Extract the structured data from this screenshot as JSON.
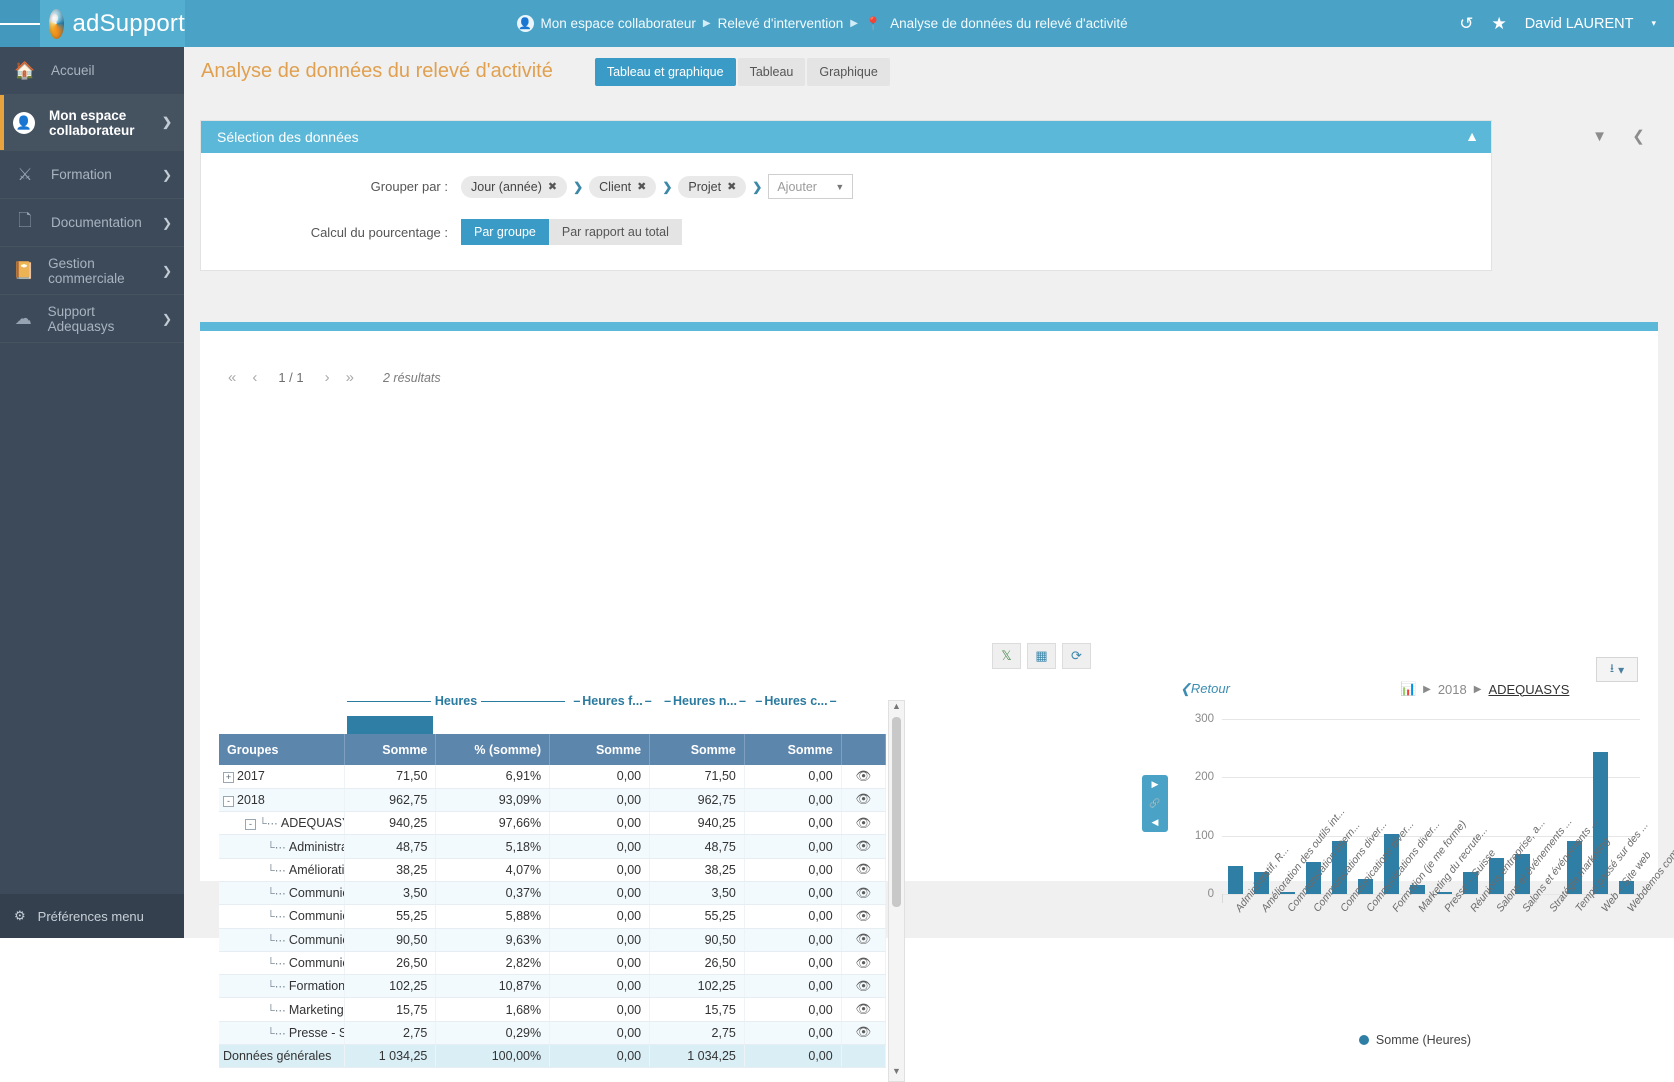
{
  "topbar": {
    "brand": "adSupport",
    "menu_icon": "hamburger-icon",
    "breadcrumb": [
      {
        "label": "Mon espace collaborateur",
        "icon": "user-circle-icon"
      },
      {
        "label": "Relevé d'intervention",
        "icon": ""
      },
      {
        "label": "Analyse de données du relevé d'activité",
        "icon": "pin-icon"
      }
    ],
    "history_icon": "history-icon",
    "favorite_icon": "star-icon",
    "user": "David LAURENT",
    "user_caret": "▾"
  },
  "sidebar": {
    "items": [
      {
        "label": "Accueil",
        "icon": "home-icon",
        "chevron": "",
        "active": false
      },
      {
        "label": "Mon espace collaborateur",
        "icon": "user-circle-icon",
        "chevron": "❯",
        "active": true
      },
      {
        "label": "Formation",
        "icon": "training-icon",
        "chevron": "❯",
        "active": false
      },
      {
        "label": "Documentation",
        "icon": "documents-icon",
        "chevron": "❯",
        "active": false
      },
      {
        "label": "Gestion commerciale",
        "icon": "contact-book-icon",
        "chevron": "❯",
        "active": false
      },
      {
        "label": "Support Adequasys",
        "icon": "support-cloud-icon",
        "chevron": "❯",
        "active": false
      }
    ],
    "footer": {
      "label": "Préférences menu",
      "icon": "gear-icon"
    }
  },
  "page": {
    "title": "Analyse de données du relevé d'activité",
    "tabs": [
      {
        "label": "Tableau et graphique",
        "selected": true
      },
      {
        "label": "Tableau",
        "selected": false
      },
      {
        "label": "Graphique",
        "selected": false
      }
    ]
  },
  "selection_panel": {
    "title": "Sélection des données",
    "collapse_icon": "chevron-up-icon",
    "group_by_label": "Grouper par :",
    "group_by_chips": [
      "Jour (année)",
      "Client",
      "Projet"
    ],
    "chip_remove_glyph": "✖",
    "arrow_glyph": "❯",
    "add_placeholder": "Ajouter",
    "percent_label": "Calcul du pourcentage :",
    "percent_options": [
      {
        "label": "Par groupe",
        "selected": true
      },
      {
        "label": "Par rapport au total",
        "selected": false
      }
    ]
  },
  "side_tools": [
    {
      "name": "filter-icon",
      "glyph": "▼"
    },
    {
      "name": "collapse-panel-icon",
      "glyph": "❮"
    }
  ],
  "results": {
    "pager": {
      "first": "«",
      "prev": "‹",
      "page": "1 / 1",
      "next": "›",
      "last": "»",
      "count": "2 résultats"
    },
    "table_tools": [
      {
        "name": "export-excel-icon",
        "glyph": "X"
      },
      {
        "name": "columns-icon",
        "glyph": "▥"
      },
      {
        "name": "refresh-icon",
        "glyph": "⟳"
      }
    ],
    "group_headers": [
      {
        "label": "Heures",
        "wide": true
      },
      {
        "label": "Heures f...",
        "wide": false
      },
      {
        "label": "Heures n...",
        "wide": false
      },
      {
        "label": "Heures c...",
        "wide": false
      }
    ],
    "columns": [
      "Groupes",
      "Somme",
      "% (somme)",
      "Somme",
      "Somme",
      "Somme",
      ""
    ],
    "rows": [
      {
        "indent": 0,
        "toggle": "+",
        "label": "2017",
        "c1": "71,50",
        "c2": "6,91%",
        "c3": "0,00",
        "c4": "71,50",
        "c5": "0,00",
        "eye": "👁"
      },
      {
        "indent": 0,
        "toggle": "-",
        "label": "2018",
        "c1": "962,75",
        "c2": "93,09%",
        "c3": "0,00",
        "c4": "962,75",
        "c5": "0,00",
        "eye": "👁"
      },
      {
        "indent": 1,
        "toggle": "-",
        "label": "ADEQUASYS",
        "c1": "940,25",
        "c2": "97,66%",
        "c3": "0,00",
        "c4": "940,25",
        "c5": "0,00",
        "eye": "👁"
      },
      {
        "indent": 2,
        "toggle": "",
        "label": "Administra",
        "c1": "48,75",
        "c2": "5,18%",
        "c3": "0,00",
        "c4": "48,75",
        "c5": "0,00",
        "eye": "👁"
      },
      {
        "indent": 2,
        "toggle": "",
        "label": "Améliorati",
        "c1": "38,25",
        "c2": "4,07%",
        "c3": "0,00",
        "c4": "38,25",
        "c5": "0,00",
        "eye": "👁"
      },
      {
        "indent": 2,
        "toggle": "",
        "label": "Communic",
        "c1": "3,50",
        "c2": "0,37%",
        "c3": "0,00",
        "c4": "3,50",
        "c5": "0,00",
        "eye": "👁"
      },
      {
        "indent": 2,
        "toggle": "",
        "label": "Communic",
        "c1": "55,25",
        "c2": "5,88%",
        "c3": "0,00",
        "c4": "55,25",
        "c5": "0,00",
        "eye": "👁"
      },
      {
        "indent": 2,
        "toggle": "",
        "label": "Communic",
        "c1": "90,50",
        "c2": "9,63%",
        "c3": "0,00",
        "c4": "90,50",
        "c5": "0,00",
        "eye": "👁"
      },
      {
        "indent": 2,
        "toggle": "",
        "label": "Communic",
        "c1": "26,50",
        "c2": "2,82%",
        "c3": "0,00",
        "c4": "26,50",
        "c5": "0,00",
        "eye": "👁"
      },
      {
        "indent": 2,
        "toggle": "",
        "label": "Formation",
        "c1": "102,25",
        "c2": "10,87%",
        "c3": "0,00",
        "c4": "102,25",
        "c5": "0,00",
        "eye": "👁"
      },
      {
        "indent": 2,
        "toggle": "",
        "label": "Marketing",
        "c1": "15,75",
        "c2": "1,68%",
        "c3": "0,00",
        "c4": "15,75",
        "c5": "0,00",
        "eye": "👁"
      },
      {
        "indent": 2,
        "toggle": "",
        "label": "Presse - S",
        "c1": "2,75",
        "c2": "0,29%",
        "c3": "0,00",
        "c4": "2,75",
        "c5": "0,00",
        "eye": "👁"
      }
    ],
    "total_row": {
      "label": "Données générales",
      "c1": "1 034,25",
      "c2": "100,00%",
      "c3": "0,00",
      "c4": "1 034,25",
      "c5": "0,00",
      "eye": ""
    }
  },
  "mid_toggle": {
    "expand": "▶",
    "link": "🔗",
    "collapse": "◀"
  },
  "chart_panel": {
    "back_label": "Retour",
    "back_icon": "chevron-left-icon",
    "crumb_icon": "bar-chart-icon",
    "crumbs": [
      "2018",
      "ADEQUASYS"
    ],
    "download_icon": "download-icon",
    "download_caret": "▾"
  },
  "chart_data": {
    "type": "bar",
    "title": "",
    "xlabel": "",
    "ylabel": "",
    "ylim": [
      0,
      300
    ],
    "yticks": [
      0,
      100,
      200,
      300
    ],
    "grid": true,
    "legend": "Somme (Heures)",
    "legend_position": "bottom",
    "series_color": "#2f7ea5",
    "categories": [
      "Administratif, R...",
      "Amélioration des outils int...",
      "Communication intern...",
      "Communications diver...",
      "Communications diver...",
      "Communications diver...",
      "Formation (je me forme)",
      "Marketing du recrute...",
      "Presse – Suisse",
      "Réunions entreprise, a...",
      "Salons et événements ...",
      "Salons et événements ...",
      "Stratégie marketing",
      "Temps passé sur des ...",
      "Web – Site web",
      "Webdemos commerci..."
    ],
    "values": [
      48.75,
      38.25,
      3.5,
      55.25,
      90.5,
      26.5,
      102.25,
      15.75,
      2.75,
      38.5,
      62.0,
      68.0,
      0,
      90.5,
      244.0,
      22.0
    ],
    "series": [
      {
        "name": "Somme (Heures)",
        "values": [
          48.75,
          38.25,
          3.5,
          55.25,
          90.5,
          26.5,
          102.25,
          15.75,
          2.75,
          38.5,
          62.0,
          68.0,
          0,
          90.5,
          244.0,
          22.0
        ]
      }
    ]
  }
}
